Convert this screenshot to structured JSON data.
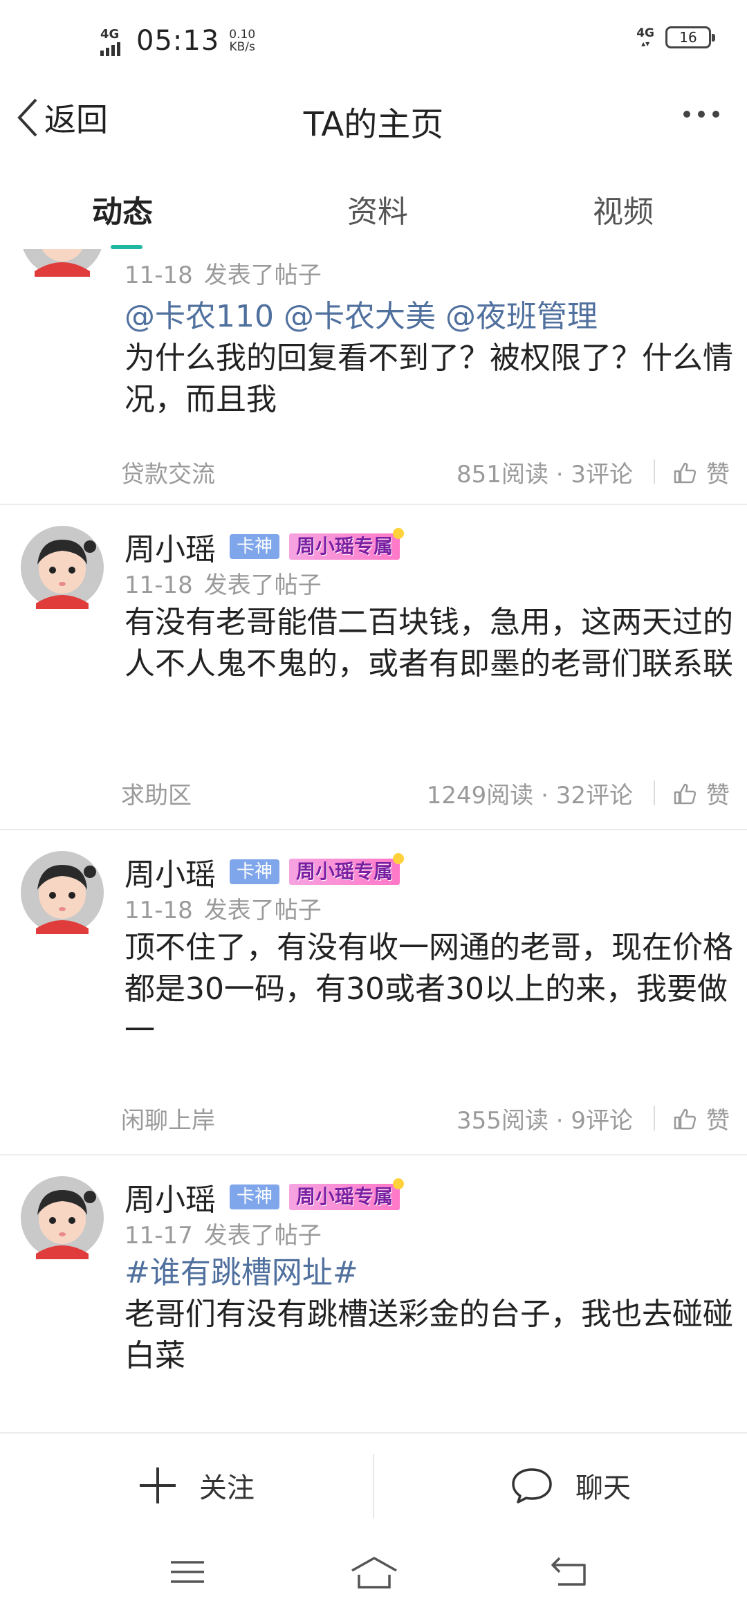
{
  "status_bar": {
    "signal_label": "4G",
    "time": "05:13",
    "net_speed_value": "0.10",
    "net_speed_unit": "KB/s",
    "right_net_label": "4G",
    "battery_level": "16"
  },
  "header": {
    "back_label": "返回",
    "title": "TA的主页"
  },
  "tabs": [
    {
      "label": "动态",
      "active": true
    },
    {
      "label": "资料",
      "active": false
    },
    {
      "label": "视频",
      "active": false
    }
  ],
  "posts": [
    {
      "username": "",
      "date": "11-18",
      "action": "发表了帖子",
      "mentions": "@卡农110 @卡农大美 @夜班管理",
      "body": "为什么我的回复看不到了？被权限了？什么情况，而且我",
      "category": "贷款交流",
      "stats": "851阅读 · 3评论",
      "like_label": "赞"
    },
    {
      "username": "周小瑶",
      "badge": "卡神",
      "tag": "周小瑶专属",
      "date": "11-18",
      "action": "发表了帖子",
      "body": "有没有老哥能借二百块钱，急用，这两天过的人不人鬼不鬼的，或者有即墨的老哥们联系联",
      "category": "求助区",
      "stats": "1249阅读 · 32评论",
      "like_label": "赞"
    },
    {
      "username": "周小瑶",
      "badge": "卡神",
      "tag": "周小瑶专属",
      "date": "11-18",
      "action": "发表了帖子",
      "body": "顶不住了，有没有收一网通的老哥，现在价格都是30一码，有30或者30以上的来，我要做一",
      "category": "闲聊上岸",
      "stats": "355阅读 · 9评论",
      "like_label": "赞"
    },
    {
      "username": "周小瑶",
      "badge": "卡神",
      "tag": "周小瑶专属",
      "date": "11-17",
      "action": "发表了帖子",
      "topic": "#谁有跳槽网址#",
      "body": "老哥们有没有跳槽送彩金的台子，我也去碰碰白菜"
    }
  ],
  "action_bar": {
    "follow_label": "关注",
    "chat_label": "聊天"
  },
  "icons": {
    "back": "chevron-left-icon",
    "more": "more-dots-icon",
    "like": "thumbs-up-icon",
    "follow": "plus-icon",
    "chat": "speech-bubble-icon",
    "nav_menu": "menu-icon",
    "nav_home": "home-icon",
    "nav_back": "return-icon"
  },
  "colors": {
    "accent": "#1fb8a3",
    "link": "#50709e",
    "badge": "#7fa6ea",
    "tag": "#ff78c8"
  }
}
